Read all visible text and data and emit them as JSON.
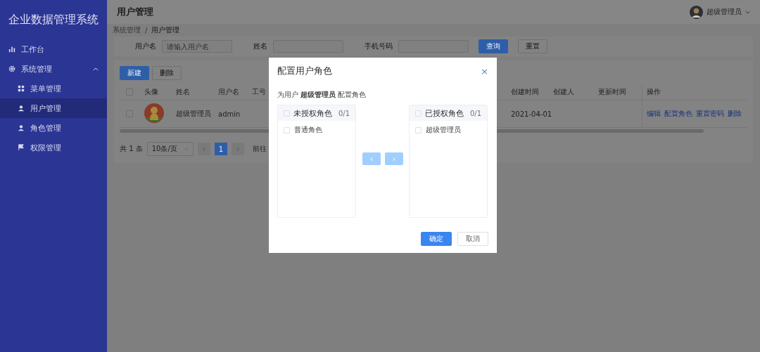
{
  "sidebar": {
    "title": "企业数据管理系统",
    "items": [
      {
        "label": "工作台",
        "selected": false
      },
      {
        "label": "系统管理",
        "selected": false,
        "expanded": true,
        "children": [
          {
            "label": "菜单管理",
            "selected": false
          },
          {
            "label": "用户管理",
            "selected": true
          },
          {
            "label": "角色管理",
            "selected": false
          },
          {
            "label": "权限管理",
            "selected": false
          }
        ]
      }
    ]
  },
  "header": {
    "title": "用户管理",
    "user": "超级管理员"
  },
  "breadcrumb": [
    "系统管理",
    "用户管理"
  ],
  "breadcrumb_separator": "/",
  "search": {
    "fields": [
      {
        "label": "用户名",
        "placeholder": "请输入用户名"
      },
      {
        "label": "姓名"
      },
      {
        "label": "手机号码"
      }
    ],
    "buttons": [
      {
        "label": "查询",
        "kind": "primary"
      },
      {
        "label": "重置",
        "kind": "default"
      }
    ]
  },
  "toolbar": [
    {
      "label": "新建",
      "kind": "primary"
    },
    {
      "label": "删除",
      "kind": "default"
    }
  ],
  "table": {
    "all_checked": false,
    "columns": [
      "头像",
      "姓名",
      "用户名",
      "工号",
      "创建时间",
      "创建人",
      "更新时间",
      "操作"
    ],
    "rows": [
      {
        "checked": false,
        "name": "超级管理员",
        "username": "admin",
        "created": "2021-04-01",
        "actions": [
          "编辑",
          "配置角色",
          "重置密码",
          "删除"
        ]
      }
    ]
  },
  "pagination": {
    "total": "共 1 条",
    "page_size": "10条/页",
    "pages": [
      {
        "label": "1",
        "selected": true
      }
    ],
    "goto": "前往"
  },
  "dialog": {
    "title": "配置用户角色",
    "close": "×",
    "intro": "为用户 **超级管理员** 配置角色",
    "panels": [
      {
        "title": "未授权角色",
        "count": "0/1",
        "checked": false,
        "items": [
          {
            "label": "普通角色",
            "checked": false
          }
        ]
      },
      {
        "title": "已授权角色",
        "count": "0/1",
        "checked": false,
        "items": [
          {
            "label": "超级管理员",
            "checked": false
          }
        ]
      }
    ],
    "arrows": [
      {
        "label": "‹",
        "disabled": true
      },
      {
        "label": "›",
        "disabled": true
      }
    ],
    "buttons": [
      {
        "label": "确定",
        "kind": "primary"
      },
      {
        "label": "取消",
        "kind": "default"
      }
    ]
  }
}
